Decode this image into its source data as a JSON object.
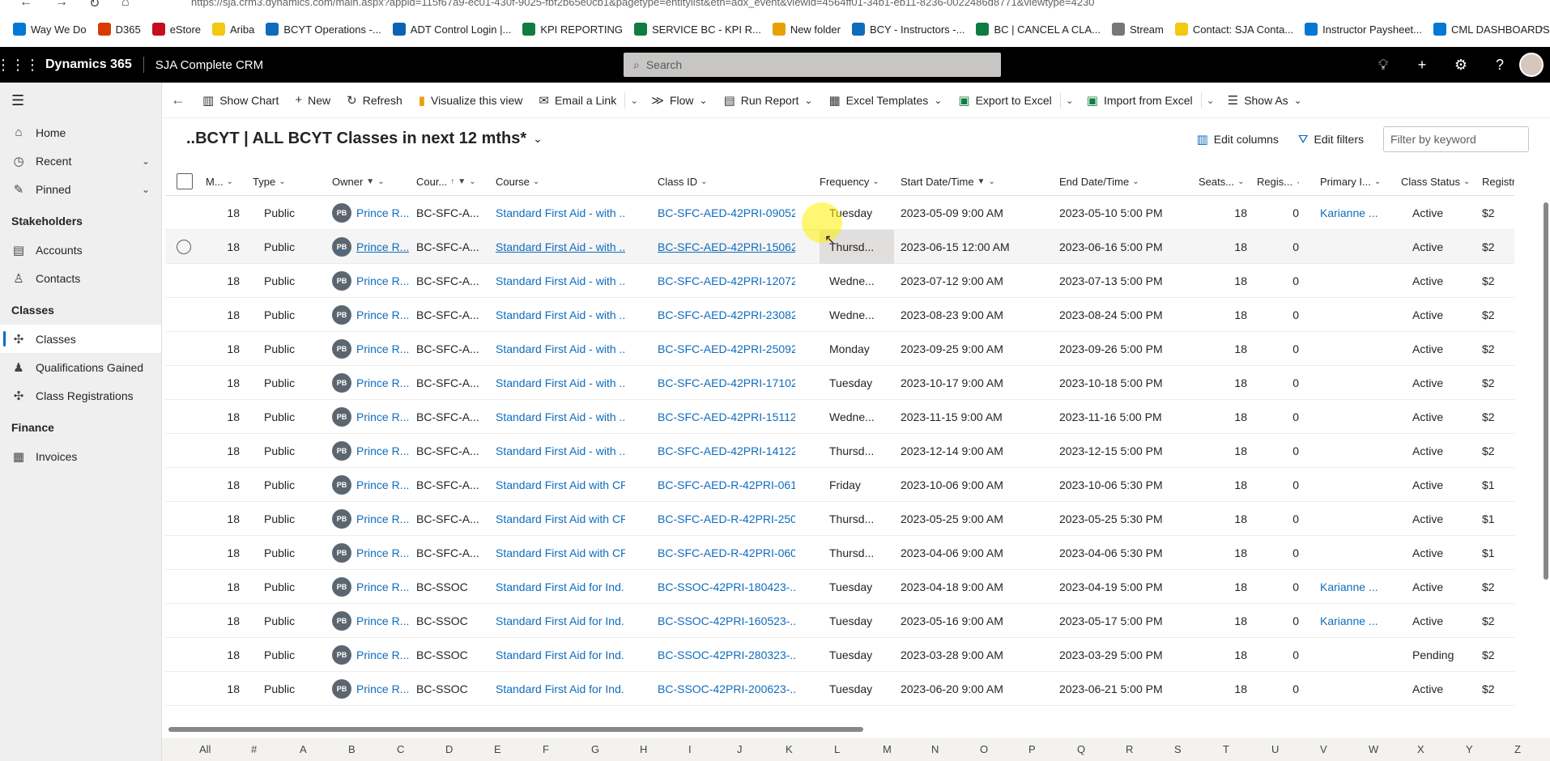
{
  "browser": {
    "url": "https://sja.crm3.dynamics.com/main.aspx?appid=115f67a9-ec01-430f-9025-fbf2b65e0cb1&pagetype=entitylist&etn=adx_event&viewid=4564ff01-34b1-eb11-8236-0022486d8771&viewtype=4230",
    "bookmarks": [
      "Way We Do",
      "D365",
      "eStore",
      "Ariba",
      "BCYT Operations -...",
      "ADT Control Login |...",
      "KPI REPORTING",
      "SERVICE BC - KPI R...",
      "New folder",
      "BCY - Instructors -...",
      "BC | CANCEL A CLA...",
      "Stream",
      "Contact: SJA Conta...",
      "Instructor Paysheet...",
      "CML DASHBOARDS"
    ]
  },
  "header": {
    "app_name": "Dynamics 365",
    "sub_app": "SJA Complete CRM",
    "search_placeholder": "Search"
  },
  "sidebar": {
    "home": "Home",
    "recent": "Recent",
    "pinned": "Pinned",
    "group_stakeholders": "Stakeholders",
    "accounts": "Accounts",
    "contacts": "Contacts",
    "group_classes": "Classes",
    "classes": "Classes",
    "qualifications": "Qualifications Gained",
    "class_registrations": "Class Registrations",
    "group_finance": "Finance",
    "invoices": "Invoices"
  },
  "commands": {
    "show_chart": "Show Chart",
    "new": "New",
    "refresh": "Refresh",
    "visualize": "Visualize this view",
    "email_link": "Email a Link",
    "flow": "Flow",
    "run_report": "Run Report",
    "excel_templates": "Excel Templates",
    "export_excel": "Export to Excel",
    "import_excel": "Import from Excel",
    "show_as": "Show As"
  },
  "view": {
    "title": "..BCYT | ALL BCYT Classes in next 12 mths*",
    "edit_columns": "Edit columns",
    "edit_filters": "Edit filters",
    "filter_placeholder": "Filter by keyword"
  },
  "columns": [
    "M...",
    "Type",
    "Owner",
    "Cour...",
    "Course",
    "Class ID",
    "Frequency",
    "Start Date/Time",
    "End Date/Time",
    "Seats...",
    "Regis...",
    "Primary I...",
    "Class Status",
    "Registrati..."
  ],
  "rows": [
    {
      "m": "18",
      "type": "Public",
      "owner": "Prince R...",
      "code": "BC-SFC-A...",
      "course": "Standard First Aid - with ...",
      "class_id": "BC-SFC-AED-42PRI-09052...",
      "freq": "Tuesday",
      "start": "2023-05-09 9:00 AM",
      "end": "2023-05-10 5:00 PM",
      "seats": "18",
      "regis": "0",
      "primary": "Karianne ...",
      "status": "Active",
      "reg": "$2"
    },
    {
      "m": "18",
      "type": "Public",
      "owner": "Prince R...",
      "code": "BC-SFC-A...",
      "course": "Standard First Aid - with ...",
      "class_id": "BC-SFC-AED-42PRI-15062...",
      "freq": "Thursd...",
      "start": "2023-06-15 12:00 AM",
      "end": "2023-06-16 5:00 PM",
      "seats": "18",
      "regis": "0",
      "primary": "",
      "status": "Active",
      "reg": "$2"
    },
    {
      "m": "18",
      "type": "Public",
      "owner": "Prince R...",
      "code": "BC-SFC-A...",
      "course": "Standard First Aid - with ...",
      "class_id": "BC-SFC-AED-42PRI-12072...",
      "freq": "Wedne...",
      "start": "2023-07-12 9:00 AM",
      "end": "2023-07-13 5:00 PM",
      "seats": "18",
      "regis": "0",
      "primary": "",
      "status": "Active",
      "reg": "$2"
    },
    {
      "m": "18",
      "type": "Public",
      "owner": "Prince R...",
      "code": "BC-SFC-A...",
      "course": "Standard First Aid - with ...",
      "class_id": "BC-SFC-AED-42PRI-23082...",
      "freq": "Wedne...",
      "start": "2023-08-23 9:00 AM",
      "end": "2023-08-24 5:00 PM",
      "seats": "18",
      "regis": "0",
      "primary": "",
      "status": "Active",
      "reg": "$2"
    },
    {
      "m": "18",
      "type": "Public",
      "owner": "Prince R...",
      "code": "BC-SFC-A...",
      "course": "Standard First Aid - with ...",
      "class_id": "BC-SFC-AED-42PRI-25092...",
      "freq": "Monday",
      "start": "2023-09-25 9:00 AM",
      "end": "2023-09-26 5:00 PM",
      "seats": "18",
      "regis": "0",
      "primary": "",
      "status": "Active",
      "reg": "$2"
    },
    {
      "m": "18",
      "type": "Public",
      "owner": "Prince R...",
      "code": "BC-SFC-A...",
      "course": "Standard First Aid - with ...",
      "class_id": "BC-SFC-AED-42PRI-17102...",
      "freq": "Tuesday",
      "start": "2023-10-17 9:00 AM",
      "end": "2023-10-18 5:00 PM",
      "seats": "18",
      "regis": "0",
      "primary": "",
      "status": "Active",
      "reg": "$2"
    },
    {
      "m": "18",
      "type": "Public",
      "owner": "Prince R...",
      "code": "BC-SFC-A...",
      "course": "Standard First Aid - with ...",
      "class_id": "BC-SFC-AED-42PRI-15112...",
      "freq": "Wedne...",
      "start": "2023-11-15 9:00 AM",
      "end": "2023-11-16 5:00 PM",
      "seats": "18",
      "regis": "0",
      "primary": "",
      "status": "Active",
      "reg": "$2"
    },
    {
      "m": "18",
      "type": "Public",
      "owner": "Prince R...",
      "code": "BC-SFC-A...",
      "course": "Standard First Aid - with ...",
      "class_id": "BC-SFC-AED-42PRI-14122...",
      "freq": "Thursd...",
      "start": "2023-12-14 9:00 AM",
      "end": "2023-12-15 5:00 PM",
      "seats": "18",
      "regis": "0",
      "primary": "",
      "status": "Active",
      "reg": "$2"
    },
    {
      "m": "18",
      "type": "Public",
      "owner": "Prince R...",
      "code": "BC-SFC-A...",
      "course": "Standard First Aid with CP...",
      "class_id": "BC-SFC-AED-R-42PRI-061...",
      "freq": "Friday",
      "start": "2023-10-06 9:00 AM",
      "end": "2023-10-06 5:30 PM",
      "seats": "18",
      "regis": "0",
      "primary": "",
      "status": "Active",
      "reg": "$1"
    },
    {
      "m": "18",
      "type": "Public",
      "owner": "Prince R...",
      "code": "BC-SFC-A...",
      "course": "Standard First Aid with CP...",
      "class_id": "BC-SFC-AED-R-42PRI-250...",
      "freq": "Thursd...",
      "start": "2023-05-25 9:00 AM",
      "end": "2023-05-25 5:30 PM",
      "seats": "18",
      "regis": "0",
      "primary": "",
      "status": "Active",
      "reg": "$1"
    },
    {
      "m": "18",
      "type": "Public",
      "owner": "Prince R...",
      "code": "BC-SFC-A...",
      "course": "Standard First Aid with CP...",
      "class_id": "BC-SFC-AED-R-42PRI-060...",
      "freq": "Thursd...",
      "start": "2023-04-06 9:00 AM",
      "end": "2023-04-06 5:30 PM",
      "seats": "18",
      "regis": "0",
      "primary": "",
      "status": "Active",
      "reg": "$1"
    },
    {
      "m": "18",
      "type": "Public",
      "owner": "Prince R...",
      "code": "BC-SSOC",
      "course": "Standard First Aid for Ind...",
      "class_id": "BC-SSOC-42PRI-180423-...",
      "freq": "Tuesday",
      "start": "2023-04-18 9:00 AM",
      "end": "2023-04-19 5:00 PM",
      "seats": "18",
      "regis": "0",
      "primary": "Karianne ...",
      "status": "Active",
      "reg": "$2"
    },
    {
      "m": "18",
      "type": "Public",
      "owner": "Prince R...",
      "code": "BC-SSOC",
      "course": "Standard First Aid for Ind...",
      "class_id": "BC-SSOC-42PRI-160523-...",
      "freq": "Tuesday",
      "start": "2023-05-16 9:00 AM",
      "end": "2023-05-17 5:00 PM",
      "seats": "18",
      "regis": "0",
      "primary": "Karianne ...",
      "status": "Active",
      "reg": "$2"
    },
    {
      "m": "18",
      "type": "Public",
      "owner": "Prince R...",
      "code": "BC-SSOC",
      "course": "Standard First Aid for Ind...",
      "class_id": "BC-SSOC-42PRI-280323-...",
      "freq": "Tuesday",
      "start": "2023-03-28 9:00 AM",
      "end": "2023-03-29 5:00 PM",
      "seats": "18",
      "regis": "0",
      "primary": "",
      "status": "Pending",
      "reg": "$2"
    },
    {
      "m": "18",
      "type": "Public",
      "owner": "Prince R...",
      "code": "BC-SSOC",
      "course": "Standard First Aid for Ind...",
      "class_id": "BC-SSOC-42PRI-200623-...",
      "freq": "Tuesday",
      "start": "2023-06-20 9:00 AM",
      "end": "2023-06-21 5:00 PM",
      "seats": "18",
      "regis": "0",
      "primary": "",
      "status": "Active",
      "reg": "$2"
    }
  ],
  "avatar_initials": "PB",
  "jumpbar": [
    "All",
    "#",
    "A",
    "B",
    "C",
    "D",
    "E",
    "F",
    "G",
    "H",
    "I",
    "J",
    "K",
    "L",
    "M",
    "N",
    "O",
    "P",
    "Q",
    "R",
    "S",
    "T",
    "U",
    "V",
    "W",
    "X",
    "Y",
    "Z"
  ],
  "colors": {
    "link": "#0f6cbd",
    "header": "#000000",
    "sidebar": "#efefef"
  }
}
